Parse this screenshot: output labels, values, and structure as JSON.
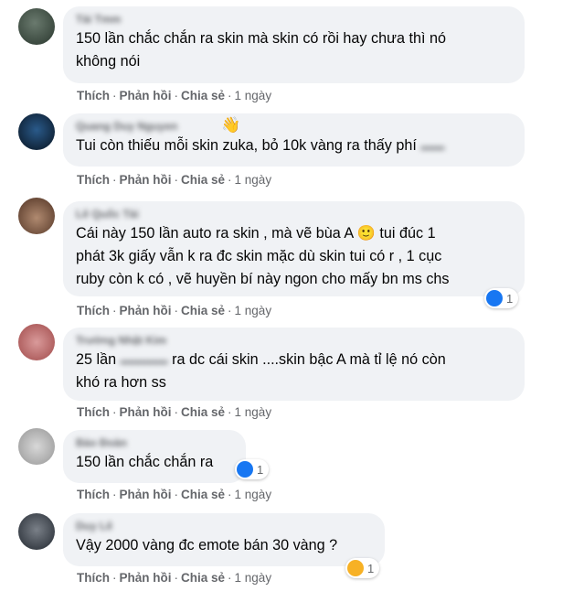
{
  "actions": {
    "like": "Thích",
    "reply": "Phản hồi",
    "share": "Chia sẻ",
    "sep": "·"
  },
  "colors": {
    "bubble": "#f0f2f5",
    "meta": "#65676b",
    "like": "#1877f2",
    "haha": "#f7b125"
  },
  "comments": [
    {
      "author": "Tài Tmm",
      "lines": [
        "150 lần chắc chắn ra skin mà skin có rồi hay chưa thì nó",
        "không nói"
      ],
      "time": "1 ngày"
    },
    {
      "author": "Quang Duy Nguyen",
      "badge_icon": "wave-icon",
      "lines": [
        "Tui còn thiếu mỗi skin zuka, bỏ 10k vàng ra thấy phí"
      ],
      "time": "1 ngày"
    },
    {
      "author": "Lê Quốc Tài",
      "lines": [
        "Cái này 150 lần auto ra skin , mà vẽ bùa A 🙂 tui đúc 1",
        "phát 3k giấy vẫn k ra đc skin mặc dù skin tui có r , 1 cục",
        "ruby còn k có , vẽ huyền bí này ngon cho mấy bn ms chs"
      ],
      "time": "1 ngày",
      "reaction": {
        "icon": "like-icon",
        "count": "1"
      }
    },
    {
      "author": "Trường Nhật Kim",
      "lines": [
        "25 lần",
        "ra dc cái skin ....skin bậc A mà tỉ lệ nó còn",
        "khó ra hơn ss"
      ],
      "time": "1 ngày"
    },
    {
      "author": "Bảo Đoàn",
      "lines": [
        "150 lần chắc chắn ra"
      ],
      "time": "1 ngày",
      "reaction": {
        "icon": "like-icon",
        "count": "1"
      }
    },
    {
      "author": "Duy Lê",
      "lines": [
        "Vậy 2000 vàng đc emote bán 30 vàng ?"
      ],
      "time": "1 ngày",
      "reaction": {
        "icon": "haha-icon",
        "count": "1"
      }
    }
  ]
}
